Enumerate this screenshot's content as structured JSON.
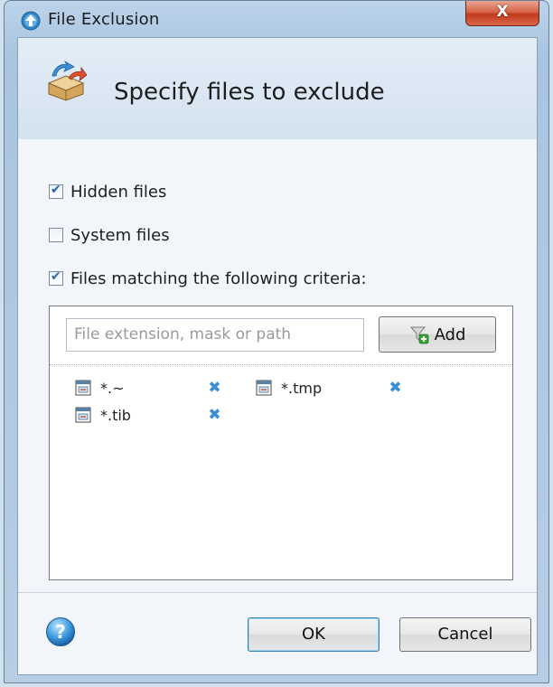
{
  "window": {
    "title": "File Exclusion",
    "close_label": "X"
  },
  "header": {
    "title": "Specify files to exclude"
  },
  "options": [
    {
      "label": "Hidden files",
      "checked": true
    },
    {
      "label": "System files",
      "checked": false
    },
    {
      "label": "Files matching the following criteria:",
      "checked": true
    }
  ],
  "criteria": {
    "placeholder": "File extension, mask or path",
    "add_label": "Add",
    "items": [
      {
        "mask": "*.~"
      },
      {
        "mask": "*.tmp"
      },
      {
        "mask": "*.tib"
      }
    ]
  },
  "footer": {
    "ok_label": "OK",
    "cancel_label": "Cancel"
  },
  "colors": {
    "accent": "#3a8fd6",
    "close_red": "#c13a1a"
  }
}
